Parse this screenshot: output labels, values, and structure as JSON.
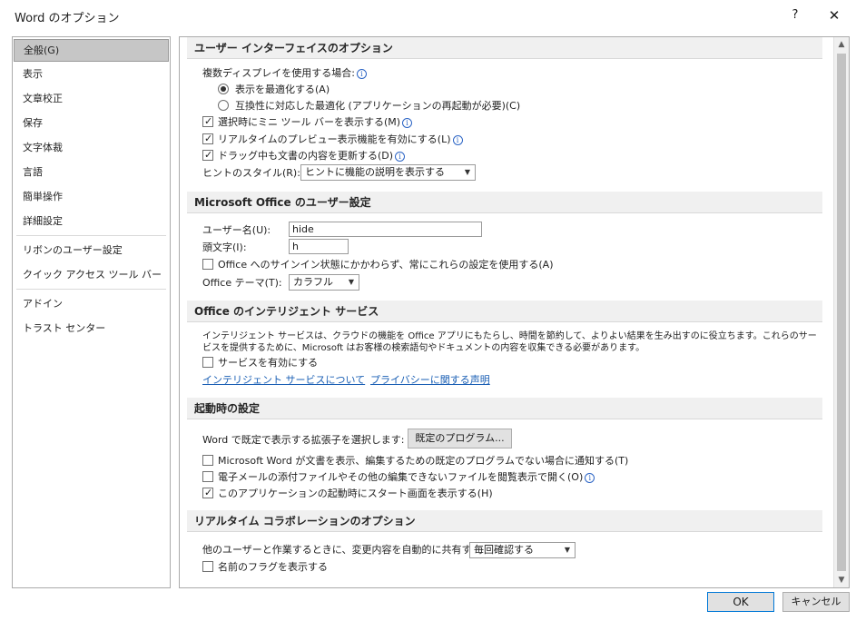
{
  "window": {
    "title": "Word のオプション",
    "help_label": "?",
    "close_label": "✕"
  },
  "sidebar": {
    "items": [
      {
        "label": "全般(G)"
      },
      {
        "label": "表示"
      },
      {
        "label": "文章校正"
      },
      {
        "label": "保存"
      },
      {
        "label": "文字体裁"
      },
      {
        "label": "言語"
      },
      {
        "label": "簡単操作"
      },
      {
        "label": "詳細設定"
      },
      {
        "label": "リボンのユーザー設定"
      },
      {
        "label": "クイック アクセス ツール バー"
      },
      {
        "label": "アドイン"
      },
      {
        "label": "トラスト センター"
      }
    ]
  },
  "ui_section": {
    "title": "ユーザー インターフェイスのオプション",
    "multi_display_label": "複数ディスプレイを使用する場合:",
    "radio_appearance": "表示を最適化する(A)",
    "radio_compat": "互換性に対応した最適化 (アプリケーションの再起動が必要)(C)",
    "mini_toolbar": "選択時にミニ ツール バーを表示する(M)",
    "live_preview": "リアルタイムのプレビュー表示機能を有効にする(L)",
    "update_doc": "ドラッグ中も文書の内容を更新する(D)",
    "screentip_label": "ヒントのスタイル(R):",
    "screentip_value": "ヒントに機能の説明を表示する"
  },
  "office_user": {
    "title": "Microsoft Office のユーザー設定",
    "username_label": "ユーザー名(U):",
    "username_value": "hide",
    "initials_label": "頭文字(I):",
    "initials_value": "h",
    "always_use": "Office へのサインイン状態にかかわらず、常にこれらの設定を使用する(A)",
    "theme_label": "Office テーマ(T):",
    "theme_value": "カラフル"
  },
  "intelligent": {
    "title": "Office のインテリジェント サービス",
    "description": "インテリジェント サービスは、クラウドの機能を Office アプリにもたらし、時間を節約して、よりよい結果を生み出すのに役立ちます。これらのサービスを提供するために、Microsoft はお客様の検索語句やドキュメントの内容を収集できる必要があります。",
    "enable_services": "サービスを有効にする",
    "link_about": "インテリジェント サービスについて",
    "link_privacy": "プライバシーに関する声明"
  },
  "startup": {
    "title": "起動時の設定",
    "default_programs_label": "Word で既定で表示する拡張子を選択します:",
    "default_programs_button": "既定のプログラム...",
    "notify_not_default": "Microsoft Word が文書を表示、編集するための既定のプログラムでない場合に通知する(T)",
    "open_attachments": "電子メールの添付ファイルやその他の編集できないファイルを閲覧表示で開く(O)",
    "show_start_screen": "このアプリケーションの起動時にスタート画面を表示する(H)"
  },
  "realtime": {
    "title": "リアルタイム コラボレーションのオプション",
    "share_changes_label": "他のユーザーと作業するときに、変更内容を自動的に共有する:",
    "share_changes_value": "毎回確認する",
    "show_names": "名前のフラグを表示する"
  },
  "footer": {
    "ok_label": "OK",
    "cancel_label": "キャンセル"
  }
}
